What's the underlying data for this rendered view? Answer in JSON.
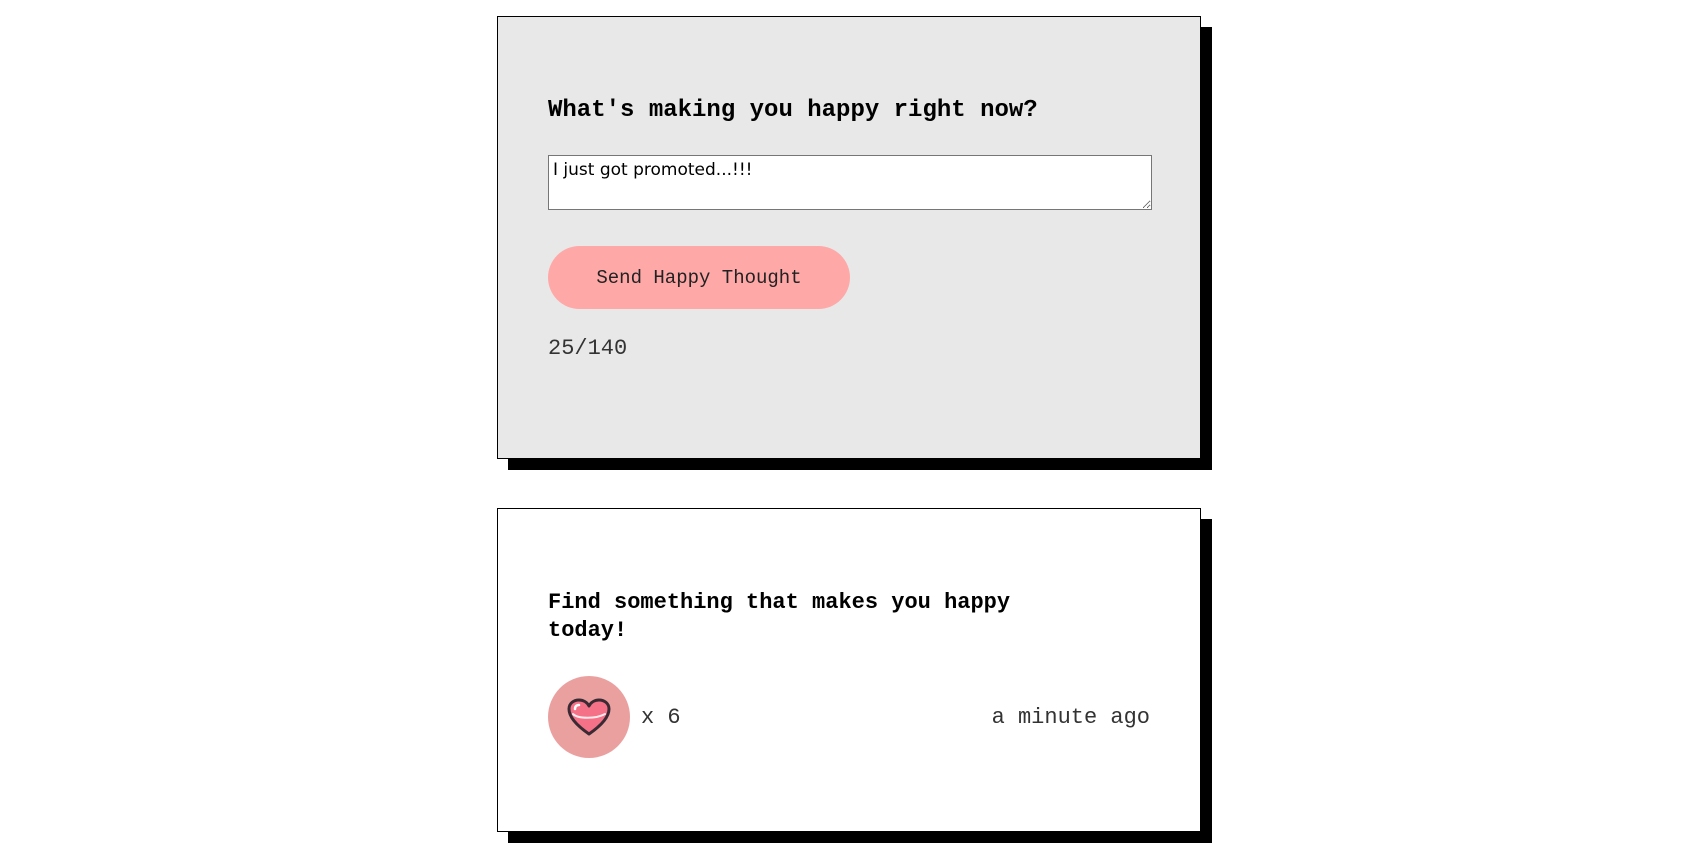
{
  "form": {
    "heading": "What's making you happy right now?",
    "input_value": "I just got promoted...!!!",
    "send_label": "Send Happy Thought",
    "char_counter": "25/140",
    "background_color": "#e8e8e8",
    "button_color": "#ffa8a8"
  },
  "thoughts": [
    {
      "message": "Find something that makes you happy today!",
      "likes_label": "x 6",
      "like_icon": "heart-icon",
      "time": "a minute ago",
      "like_button_color": "#eba0a0",
      "heart_color": "#f47188"
    }
  ]
}
